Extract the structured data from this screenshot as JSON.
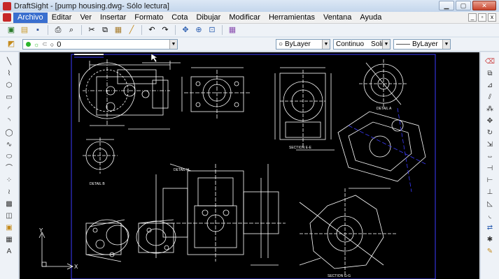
{
  "window": {
    "title": "DraftSight - [pump housing.dwg- Sólo lectura]"
  },
  "menu": {
    "items": [
      {
        "label": "Archivo",
        "active": true
      },
      {
        "label": "Editar"
      },
      {
        "label": "Ver"
      },
      {
        "label": "Insertar"
      },
      {
        "label": "Formato"
      },
      {
        "label": "Cota"
      },
      {
        "label": "Dibujar"
      },
      {
        "label": "Modificar"
      },
      {
        "label": "Herramientas"
      },
      {
        "label": "Ventana"
      },
      {
        "label": "Ayuda"
      }
    ]
  },
  "layer": {
    "current": "0"
  },
  "properties": {
    "color": "ByLayer",
    "linetype": "Continuo",
    "linetype_scale": "Solid line",
    "lineweight": "ByLayer"
  },
  "drawing": {
    "labels": {
      "detail_b": "DETAIL B",
      "detail_a": "DETAIL A",
      "section_ee": "SECTION E-E",
      "section_gg": "SECTION G-G",
      "detail_h": "DETAIL H"
    },
    "ucs": {
      "x": "X",
      "y": "Y"
    },
    "colors": {
      "background": "#000000",
      "lines": "#ffffff",
      "frame": "#3b3bff"
    }
  }
}
